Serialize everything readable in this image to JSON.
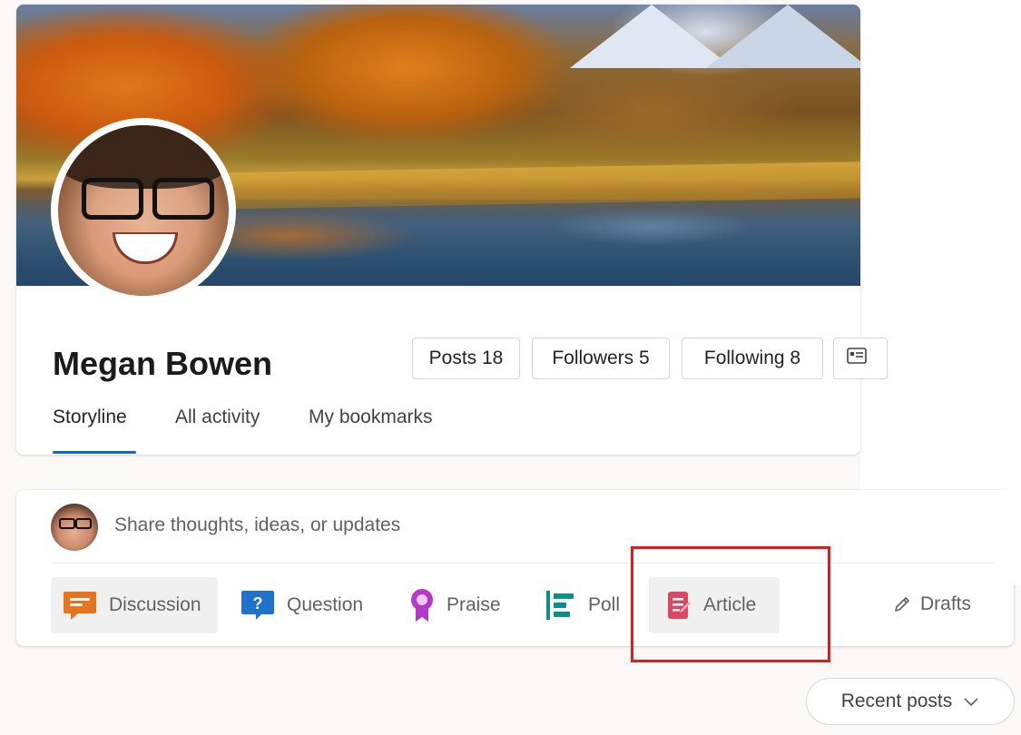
{
  "profile": {
    "name": "Megan Bowen",
    "stats": {
      "posts": "Posts 18",
      "followers": "Followers 5",
      "following": "Following 8"
    },
    "tabs": [
      "Storyline",
      "All activity",
      "My bookmarks"
    ],
    "active_tab": "Storyline"
  },
  "composer": {
    "placeholder": "Share thoughts, ideas, or updates",
    "post_types": [
      {
        "label": "Discussion",
        "icon": "discussion-icon",
        "color": "#e8731e"
      },
      {
        "label": "Question",
        "icon": "question-icon",
        "color": "#1e72c9"
      },
      {
        "label": "Praise",
        "icon": "praise-icon",
        "color": "#b23ac9"
      },
      {
        "label": "Poll",
        "icon": "poll-icon",
        "color": "#0f8c8c"
      },
      {
        "label": "Article",
        "icon": "article-icon",
        "color": "#d9485e"
      }
    ],
    "selected_type": "Discussion",
    "drafts_label": "Drafts"
  },
  "feed": {
    "sort_label": "Recent posts"
  },
  "colors": {
    "accent": "#0f6cbd",
    "highlight": "#e01b1b"
  }
}
